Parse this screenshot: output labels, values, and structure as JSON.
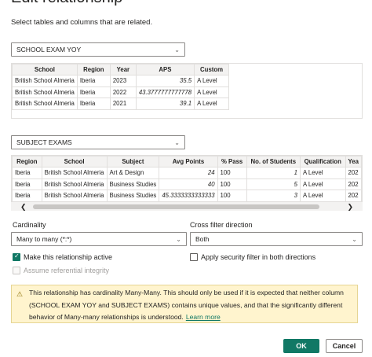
{
  "dialog": {
    "title": "Edit relationship",
    "subtitle": "Select tables and columns that are related."
  },
  "table1": {
    "select_value": "SCHOOL EXAM YOY",
    "columns": [
      "School",
      "Region",
      "Year",
      "APS",
      "Custom"
    ],
    "rows": [
      [
        "British School Almeria",
        "Iberia",
        "2023",
        "35.5",
        "A Level"
      ],
      [
        "British School Almeria",
        "Iberia",
        "2022",
        "43.3777777777778",
        "A Level"
      ],
      [
        "British School Almeria",
        "Iberia",
        "2021",
        "39.1",
        "A Level"
      ]
    ]
  },
  "table2": {
    "select_value": "SUBJECT EXAMS",
    "columns": [
      "Region",
      "School",
      "Subject",
      "Avg Points",
      "% Pass",
      "No. of Students",
      "Qualification",
      "Yea"
    ],
    "rows": [
      [
        "Iberia",
        "British School Almeria",
        "Art & Design",
        "24",
        "100",
        "1",
        "A Level",
        "202"
      ],
      [
        "Iberia",
        "British School Almeria",
        "Business Studies",
        "40",
        "100",
        "5",
        "A Level",
        "202"
      ],
      [
        "Iberia",
        "British School Almeria",
        "Business Studies",
        "45.3333333333333",
        "100",
        "3",
        "A Level",
        "202"
      ]
    ]
  },
  "cardinality": {
    "label": "Cardinality",
    "value": "Many to many (*:*)"
  },
  "cross_filter": {
    "label": "Cross filter direction",
    "value": "Both"
  },
  "options": {
    "active_label": "Make this relationship active",
    "security_label": "Apply security filter in both directions",
    "integrity_label": "Assume referential integrity"
  },
  "warning": {
    "text": "This relationship has cardinality Many-Many. This should only be used if it is expected that neither column (SCHOOL EXAM YOY and SUBJECT EXAMS) contains unique values, and that the significantly different behavior of Many-many relationships is understood.",
    "link": "Learn more"
  },
  "buttons": {
    "ok": "OK",
    "cancel": "Cancel"
  },
  "colors": {
    "accent": "#117865",
    "warning_bg": "#fff4ce"
  }
}
